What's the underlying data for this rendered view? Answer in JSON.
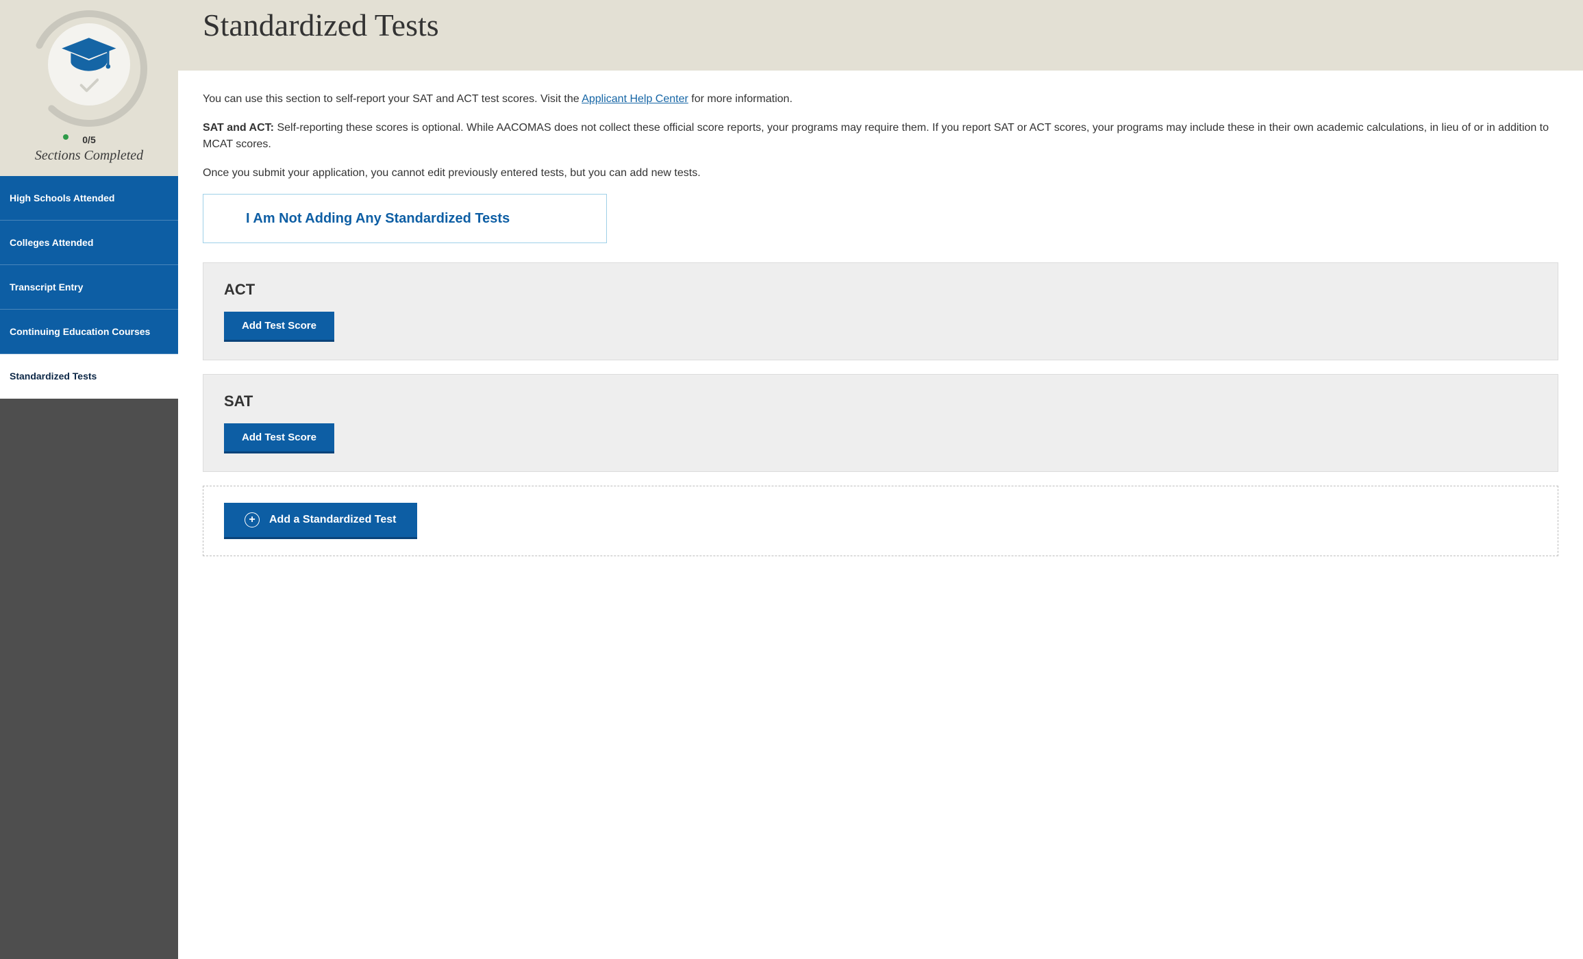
{
  "sidebar": {
    "progress": {
      "count": "0/5",
      "label": "Sections Completed"
    },
    "nav": [
      {
        "label": "High Schools Attended",
        "active": false
      },
      {
        "label": "Colleges Attended",
        "active": false
      },
      {
        "label": "Transcript Entry",
        "active": false
      },
      {
        "label": "Continuing Education Courses",
        "active": false
      },
      {
        "label": "Standardized Tests",
        "active": true
      }
    ]
  },
  "header": {
    "title": "Standardized Tests"
  },
  "intro": {
    "p1_pre": "You can use this section to self-report your SAT and ACT test scores. Visit the ",
    "p1_link": "Applicant Help Center",
    "p1_post": " for more information.",
    "p2_label": "SAT and ACT:",
    "p2_body": " Self-reporting these scores is optional. While AACOMAS does not collect these official score reports, your programs may require them. If you report SAT or ACT scores, your programs may include these in their own academic calculations, in lieu of or in addition to MCAT scores.",
    "p3": "Once you submit your application, you cannot edit previously entered tests, but you can add new tests."
  },
  "opt_out": {
    "label": "I Am Not Adding Any Standardized Tests"
  },
  "tests": [
    {
      "name": "ACT",
      "button": "Add Test Score"
    },
    {
      "name": "SAT",
      "button": "Add Test Score"
    }
  ],
  "add_test": {
    "label": "Add a Standardized Test"
  }
}
